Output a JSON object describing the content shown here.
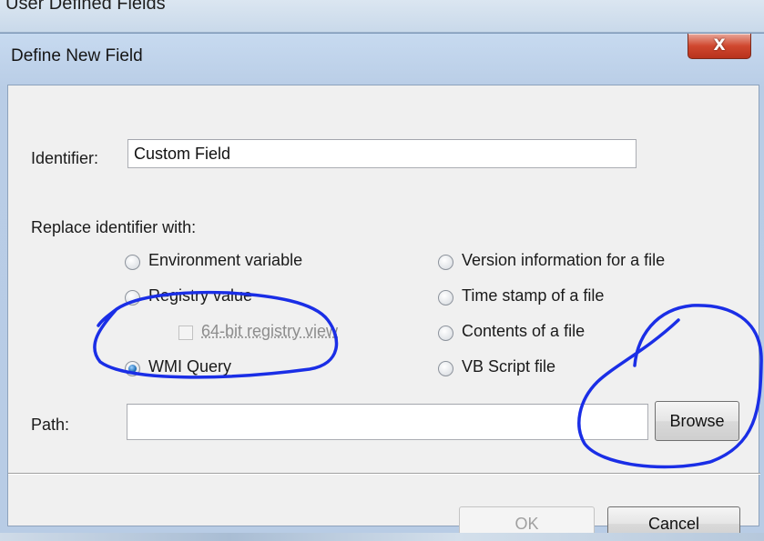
{
  "background_window": {
    "title": "User Defined Fields"
  },
  "dialog": {
    "title": "Define New Field",
    "close_glyph": "X"
  },
  "identifier": {
    "label": "Identifier:",
    "value": "Custom Field"
  },
  "replace": {
    "label": "Replace identifier with:",
    "options": {
      "env_var": "Environment variable",
      "registry": "Registry value",
      "registry_64": "64-bit registry view",
      "wmi": "WMI Query",
      "version_info": "Version information for a file",
      "timestamp": "Time stamp of a file",
      "contents": "Contents of a file",
      "vbscript": "VB Script file"
    },
    "selected": "WMI Query"
  },
  "path": {
    "label": "Path:",
    "value": "",
    "browse_label": "Browse"
  },
  "buttons": {
    "ok": "OK",
    "cancel": "Cancel"
  },
  "annotation_color": "#1a2ee6"
}
